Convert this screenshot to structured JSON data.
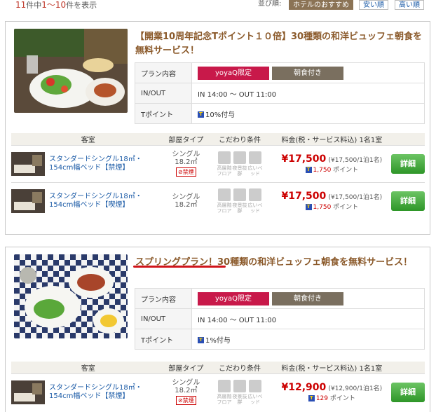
{
  "results": {
    "total": "11",
    "total_suffix": "件中",
    "range": "1〜10",
    "range_suffix": "件を表示"
  },
  "sort": {
    "label": "並び順:",
    "options": [
      "ホテルのおすすめ",
      "安い順",
      "高い順"
    ]
  },
  "table_headers": {
    "room": "客室",
    "type": "部屋タイプ",
    "cond": "こだわり条件",
    "price": "料金(税・サービス料込) 1名1室"
  },
  "labels": {
    "plan_content": "プラン内容",
    "inout": "IN/OUT",
    "tpoint": "Tポイント",
    "detail": "詳細"
  },
  "conditions": [
    "高層階フロア",
    "夜景抜群",
    "広いベッド"
  ],
  "plans": [
    {
      "title": "【開業10周年記念Tポイント１０倍】30種類の和洋ビュッフェ朝食を無料サービス！",
      "tags": [
        "yoyaQ限定",
        "朝食付き"
      ],
      "inout": "IN 14:00 〜 OUT 11:00",
      "tpoint": "10%付与",
      "rooms": [
        {
          "name": "スタンダードシングル18㎡・154cm幅ベッド【禁煙】",
          "type": "シングル",
          "size": "18.2㎡",
          "smoke_badge": "禁煙",
          "price": "¥17,500",
          "sub": "(¥17,500/1泊1名)",
          "points": "1,750",
          "points_label": "ポイント"
        },
        {
          "name": "スタンダードシングル18㎡・154cm幅ベッド【喫煙】",
          "type": "シングル",
          "size": "18.2㎡",
          "smoke_badge": "",
          "price": "¥17,500",
          "sub": "(¥17,500/1泊1名)",
          "points": "1,750",
          "points_label": "ポイント"
        }
      ]
    },
    {
      "title_underlined": "スプリングプラン！",
      "title_rest": "30種類の和洋ビュッフェ朝食を無料サービス！",
      "tags": [
        "yoyaQ限定",
        "朝食付き"
      ],
      "inout": "IN 14:00 〜 OUT 11:00",
      "tpoint": "1%付与",
      "rooms": [
        {
          "name": "スタンダードシングル18㎡・154cm幅ベッド【禁煙】",
          "type": "シングル",
          "size": "18.2㎡",
          "smoke_badge": "禁煙",
          "price": "¥12,900",
          "sub": "(¥12,900/1泊1名)",
          "points": "129",
          "points_label": "ポイント"
        }
      ]
    }
  ]
}
